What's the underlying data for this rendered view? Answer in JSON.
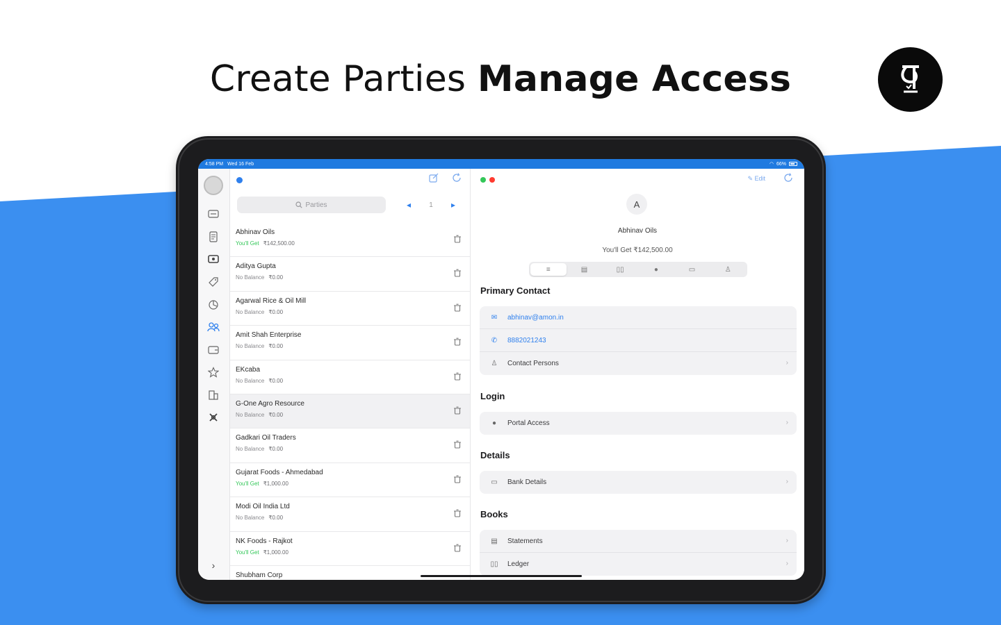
{
  "colors": {
    "accent": "#2f80ed",
    "background_blue": "#3b8ff0",
    "you_get_green": "#34c759"
  },
  "headline": {
    "light": "Create Parties ",
    "bold": "Manage Access"
  },
  "logo": {
    "icon": "brand-logo-icon"
  },
  "status_bar": {
    "time": "4:58 PM",
    "date": "Wed 16 Feb",
    "battery": "66%"
  },
  "rail": {
    "icons": [
      "avatar",
      "invoice-icon",
      "document-icon",
      "cash-icon",
      "tag-icon",
      "reports-icon",
      "parties-icon",
      "wallet-icon",
      "favorites-icon",
      "building-icon",
      "tools-icon"
    ],
    "active": "parties-icon",
    "collapse_icon": "chevron-right-icon"
  },
  "list": {
    "search_placeholder": "Parties",
    "page": "1",
    "rows": [
      {
        "name": "Abhinav Oils",
        "status": "You'll Get",
        "amount": "₹142,500.00",
        "type": "get"
      },
      {
        "name": "Aditya Gupta",
        "status": "No Balance",
        "amount": "₹0.00",
        "type": "none"
      },
      {
        "name": "Agarwal Rice & Oil Mill",
        "status": "No Balance",
        "amount": "₹0.00",
        "type": "none"
      },
      {
        "name": "Amit Shah Enterprise",
        "status": "No Balance",
        "amount": "₹0.00",
        "type": "none"
      },
      {
        "name": "EKcaba",
        "status": "No Balance",
        "amount": "₹0.00",
        "type": "none"
      },
      {
        "name": "G-One Agro Resource",
        "status": "No Balance",
        "amount": "₹0.00",
        "type": "none"
      },
      {
        "name": "Gadkari Oil Traders",
        "status": "No Balance",
        "amount": "₹0.00",
        "type": "none"
      },
      {
        "name": "Gujarat Foods - Ahmedabad",
        "status": "You'll Get",
        "amount": "₹1,000.00",
        "type": "get"
      },
      {
        "name": "Modi Oil India Ltd",
        "status": "No Balance",
        "amount": "₹0.00",
        "type": "none"
      },
      {
        "name": "NK Foods - Rajkot",
        "status": "You'll Get",
        "amount": "₹1,000.00",
        "type": "get"
      },
      {
        "name": "Shubham Corp",
        "status": "",
        "amount": "",
        "type": "none"
      }
    ],
    "selected_index": 5
  },
  "detail": {
    "edit_label": "Edit",
    "avatar_letter": "A",
    "name": "Abhinav Oils",
    "balance": "You'll Get  ₹142,500.00",
    "segments": [
      "list-icon",
      "document-icon",
      "book-icon",
      "globe-icon",
      "card-icon",
      "person-icon"
    ],
    "primary_contact": {
      "title": "Primary Contact",
      "email": "abhinav@amon.in",
      "phone": "8882021243",
      "contact_persons": "Contact Persons"
    },
    "login": {
      "title": "Login",
      "portal_access": "Portal Access"
    },
    "details": {
      "title": "Details",
      "bank_details": "Bank Details"
    },
    "books": {
      "title": "Books",
      "statements": "Statements",
      "ledger": "Ledger"
    }
  }
}
